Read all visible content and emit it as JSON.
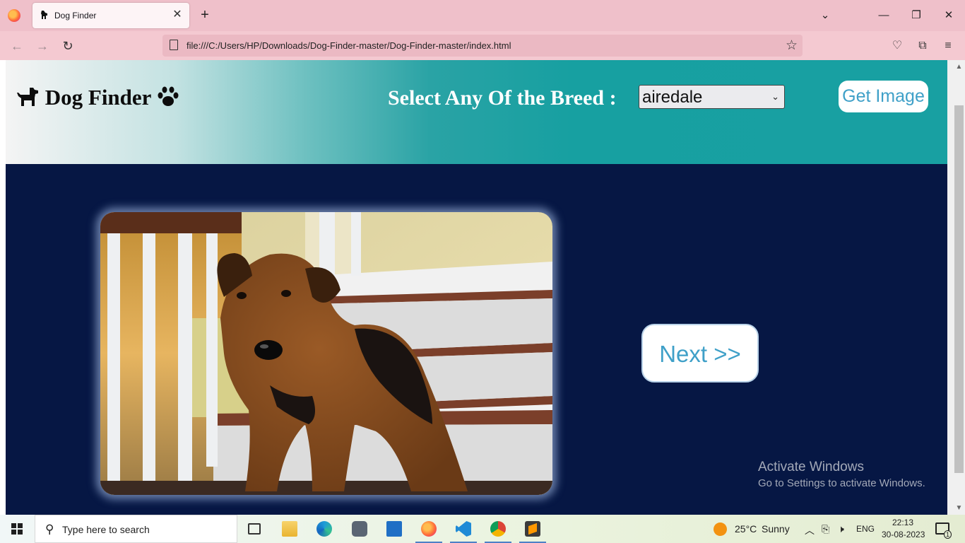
{
  "browser": {
    "tab_title": "Dog Finder",
    "url": "file:///C:/Users/HP/Downloads/Dog-Finder-master/Dog-Finder-master/index.html"
  },
  "page": {
    "brand": "Dog Finder",
    "breed_label": "Select Any Of the Breed :",
    "breed_select": {
      "selected": "airedale"
    },
    "get_image_button": "Get Image",
    "next_button": "Next >>",
    "dog_image_subject": "airedale terrier puppy on stairs"
  },
  "watermark": {
    "line1": "Activate Windows",
    "line2": "Go to Settings to activate Windows."
  },
  "taskbar": {
    "search_placeholder": "Type here to search",
    "apps": [
      "task-view-icon",
      "file-explorer-icon",
      "edge-icon",
      "camera-icon",
      "mail-icon",
      "firefox-icon",
      "vscode-icon",
      "chrome-icon",
      "sublime-icon"
    ],
    "weather_temp": "25°C",
    "weather_text": "Sunny",
    "language": "ENG",
    "time": "22:13",
    "date": "30-08-2023",
    "notification_count": "1"
  },
  "colors": {
    "header_teal": "#18a0a2",
    "content_navy": "#061744",
    "button_text_blue": "#3fa0c8",
    "browser_chrome_pink": "#efc0ca"
  }
}
